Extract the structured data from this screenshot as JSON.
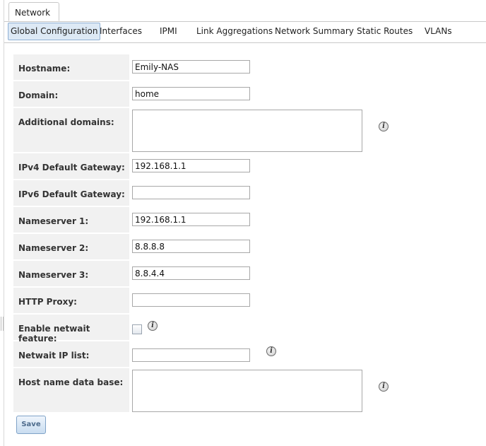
{
  "window_tab": {
    "label": "Network"
  },
  "subtabs": [
    {
      "label": "Global Configuration",
      "active": true
    },
    {
      "label": "Interfaces"
    },
    {
      "label": "IPMI"
    },
    {
      "label": "Link Aggregations"
    },
    {
      "label": "Network Summary"
    },
    {
      "label": "Static Routes"
    },
    {
      "label": "VLANs"
    }
  ],
  "form": {
    "hostname": {
      "label": "Hostname:",
      "value": "Emily-NAS"
    },
    "domain": {
      "label": "Domain:",
      "value": "home"
    },
    "additional_domains": {
      "label": "Additional domains:",
      "value": ""
    },
    "ipv4_gateway": {
      "label": "IPv4 Default Gateway:",
      "value": "192.168.1.1"
    },
    "ipv6_gateway": {
      "label": "IPv6 Default Gateway:",
      "value": ""
    },
    "nameserver1": {
      "label": "Nameserver 1:",
      "value": "192.168.1.1"
    },
    "nameserver2": {
      "label": "Nameserver 2:",
      "value": "8.8.8.8"
    },
    "nameserver3": {
      "label": "Nameserver 3:",
      "value": "8.8.4.4"
    },
    "http_proxy": {
      "label": "HTTP Proxy:",
      "value": ""
    },
    "netwait_enable": {
      "label": "Enable netwait feature:",
      "checked": false
    },
    "netwait_ips": {
      "label": "Netwait IP list:",
      "value": ""
    },
    "hosts_db": {
      "label": "Host name data base:",
      "value": ""
    }
  },
  "info_glyph": "i",
  "save_label": "Save",
  "icons": {
    "info": "info-icon"
  }
}
